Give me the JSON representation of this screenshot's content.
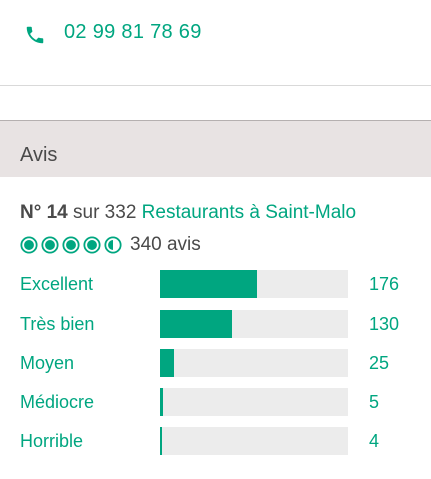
{
  "contact": {
    "phone_icon": "phone-icon",
    "phone_number": "02 99 81 78 69"
  },
  "reviews": {
    "section_title": "Avis",
    "rank": {
      "number": "N° 14",
      "middle": " sur 332 ",
      "link": "Restaurants à Saint-Malo"
    },
    "rating": {
      "bubbles_filled": 4.5,
      "bubbles_total": 5,
      "count_text": "340 avis"
    },
    "accent_color": "#00a680",
    "distribution": [
      {
        "label": "Excellent",
        "count": 176,
        "count_text": "176"
      },
      {
        "label": "Très bien",
        "count": 130,
        "count_text": "130"
      },
      {
        "label": "Moyen",
        "count": 25,
        "count_text": "25"
      },
      {
        "label": "Médiocre",
        "count": 5,
        "count_text": "5"
      },
      {
        "label": "Horrible",
        "count": 4,
        "count_text": "4"
      }
    ]
  }
}
